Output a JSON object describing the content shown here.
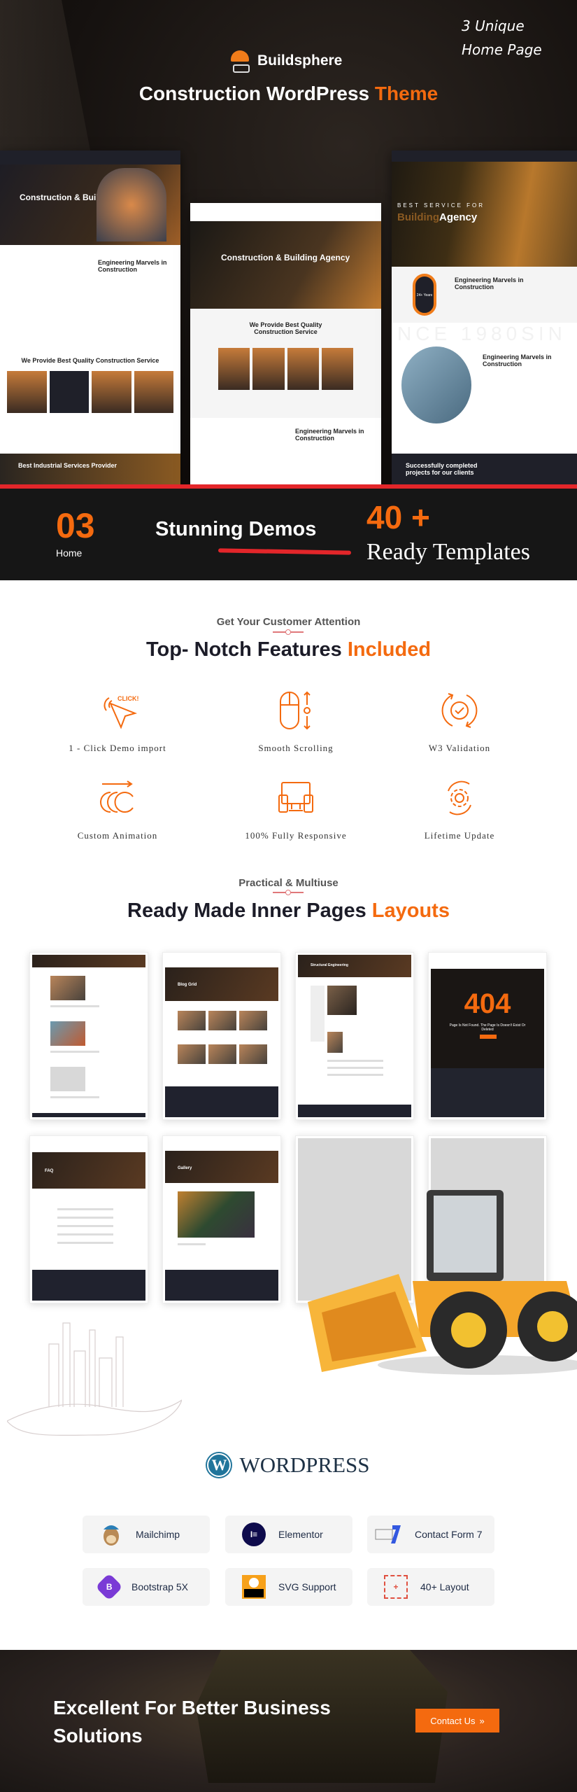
{
  "hero": {
    "brand": "Buildsphere",
    "title_main": "Construction WordPress ",
    "title_accent": "Theme",
    "badge_line1": "3 Unique",
    "badge_line2": "Home Page"
  },
  "demos": [
    {
      "title": "Construction & Building Agency",
      "about": "Engineering Marvels in Construction",
      "service": "We Provide Best Quality Construction Service",
      "footer": "Best Industrial Services Provider"
    },
    {
      "title": "Construction & Building Agency",
      "service": "We Provide Best Quality Construction Service",
      "about": "Engineering Marvels in Construction"
    },
    {
      "eyebrow": "BEST SERVICE FOR",
      "title_dim": "Building",
      "title_bright": "Agency",
      "about": "Engineering Marvels in Construction",
      "badge": "24+ Years",
      "watermark": "NCE 1980SIN",
      "about2": "Engineering Marvels in Construction",
      "footer": "Successfully completed projects for our clients"
    }
  ],
  "stats": {
    "home_count": "03",
    "home_label": "Home",
    "demos_label": "Stunning Demos",
    "templates_count": "40 +",
    "templates_label": "Ready Templates"
  },
  "features": {
    "eyebrow": "Get Your Customer Attention",
    "title_main": "Top- Notch Features ",
    "title_accent": "Included",
    "items": [
      {
        "label": "1 - Click Demo import",
        "icon": "click-icon"
      },
      {
        "label": "Smooth Scrolling",
        "icon": "mouse-scroll-icon"
      },
      {
        "label": "W3 Validation",
        "icon": "check-refresh-icon"
      },
      {
        "label": "Custom Animation",
        "icon": "animation-icon"
      },
      {
        "label": "100% Fully Responsive",
        "icon": "devices-icon"
      },
      {
        "label": "Lifetime Update",
        "icon": "gear-refresh-icon"
      }
    ]
  },
  "inner": {
    "eyebrow": "Practical & Multiuse",
    "title_main": "Ready Made Inner Pages ",
    "title_accent": "Layouts",
    "pages": [
      {
        "label": ""
      },
      {
        "label": "Blog Grid"
      },
      {
        "label": "Structural Engineering"
      },
      {
        "label": "404",
        "sub": "Page Is Not Found. The Page Is Doesn't Exist Or Deleted"
      },
      {
        "label": "FAQ"
      },
      {
        "label": "Gallery"
      }
    ]
  },
  "wordpress": {
    "label": "WORDPRESS"
  },
  "plugins": [
    {
      "label": "Mailchimp",
      "icon": "mailchimp-icon"
    },
    {
      "label": "Elementor",
      "icon": "elementor-icon"
    },
    {
      "label": "Contact Form 7",
      "icon": "contact-form-7-icon"
    },
    {
      "label": "Bootstrap 5X",
      "icon": "bootstrap-icon"
    },
    {
      "label": "SVG Support",
      "icon": "svg-icon"
    },
    {
      "label": "40+ Layout",
      "icon": "layout-icon"
    }
  ],
  "cta": {
    "line1": "Excellent For Better Business",
    "line2": "Solutions",
    "button": "Contact Us"
  },
  "colors": {
    "accent": "#f46a0f",
    "dark": "#161616",
    "red": "#e3262a"
  }
}
